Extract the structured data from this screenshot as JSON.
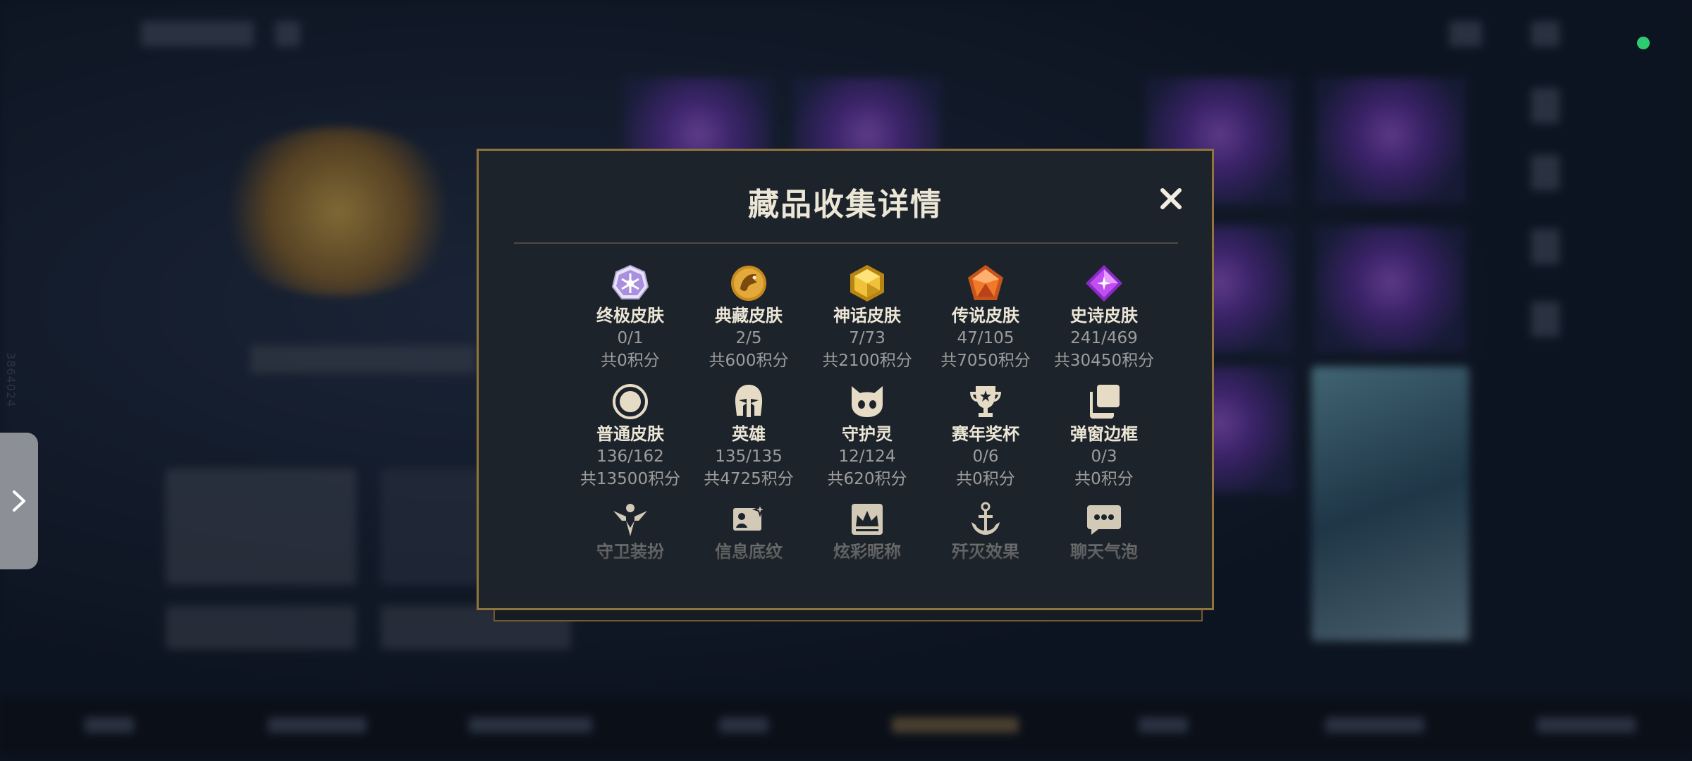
{
  "modal": {
    "title": "藏品收集详情",
    "rows": [
      [
        {
          "name": "终极皮肤",
          "count": "0/1",
          "points": "共0积分",
          "icon": "ultimate-skin-icon"
        },
        {
          "name": "典藏皮肤",
          "count": "2/5",
          "points": "共600积分",
          "icon": "collector-skin-icon"
        },
        {
          "name": "神话皮肤",
          "count": "7/73",
          "points": "共2100积分",
          "icon": "mythic-skin-icon"
        },
        {
          "name": "传说皮肤",
          "count": "47/105",
          "points": "共7050积分",
          "icon": "legendary-skin-icon"
        },
        {
          "name": "史诗皮肤",
          "count": "241/469",
          "points": "共30450积分",
          "icon": "epic-skin-icon"
        }
      ],
      [
        {
          "name": "普通皮肤",
          "count": "136/162",
          "points": "共13500积分",
          "icon": "common-skin-icon"
        },
        {
          "name": "英雄",
          "count": "135/135",
          "points": "共4725积分",
          "icon": "hero-helmet-icon"
        },
        {
          "name": "守护灵",
          "count": "12/124",
          "points": "共620积分",
          "icon": "guardian-spirit-icon"
        },
        {
          "name": "赛年奖杯",
          "count": "0/6",
          "points": "共0积分",
          "icon": "trophy-icon"
        },
        {
          "name": "弹窗边框",
          "count": "0/3",
          "points": "共0积分",
          "icon": "popup-frame-icon"
        }
      ],
      [
        {
          "name": "守卫装扮",
          "icon": "guard-outfit-icon"
        },
        {
          "name": "信息底纹",
          "icon": "info-background-icon"
        },
        {
          "name": "炫彩昵称",
          "icon": "colorful-nickname-icon"
        },
        {
          "name": "歼灭效果",
          "icon": "annihilation-effect-icon"
        },
        {
          "name": "聊天气泡",
          "icon": "chat-bubble-icon"
        }
      ]
    ]
  },
  "background": {
    "vertical_id": "3864024"
  },
  "colors": {
    "accent_gold": "#8f7440",
    "text_primary": "#ece6d6",
    "text_secondary": "#9d9d9d",
    "status_green": "#2ecc71"
  }
}
